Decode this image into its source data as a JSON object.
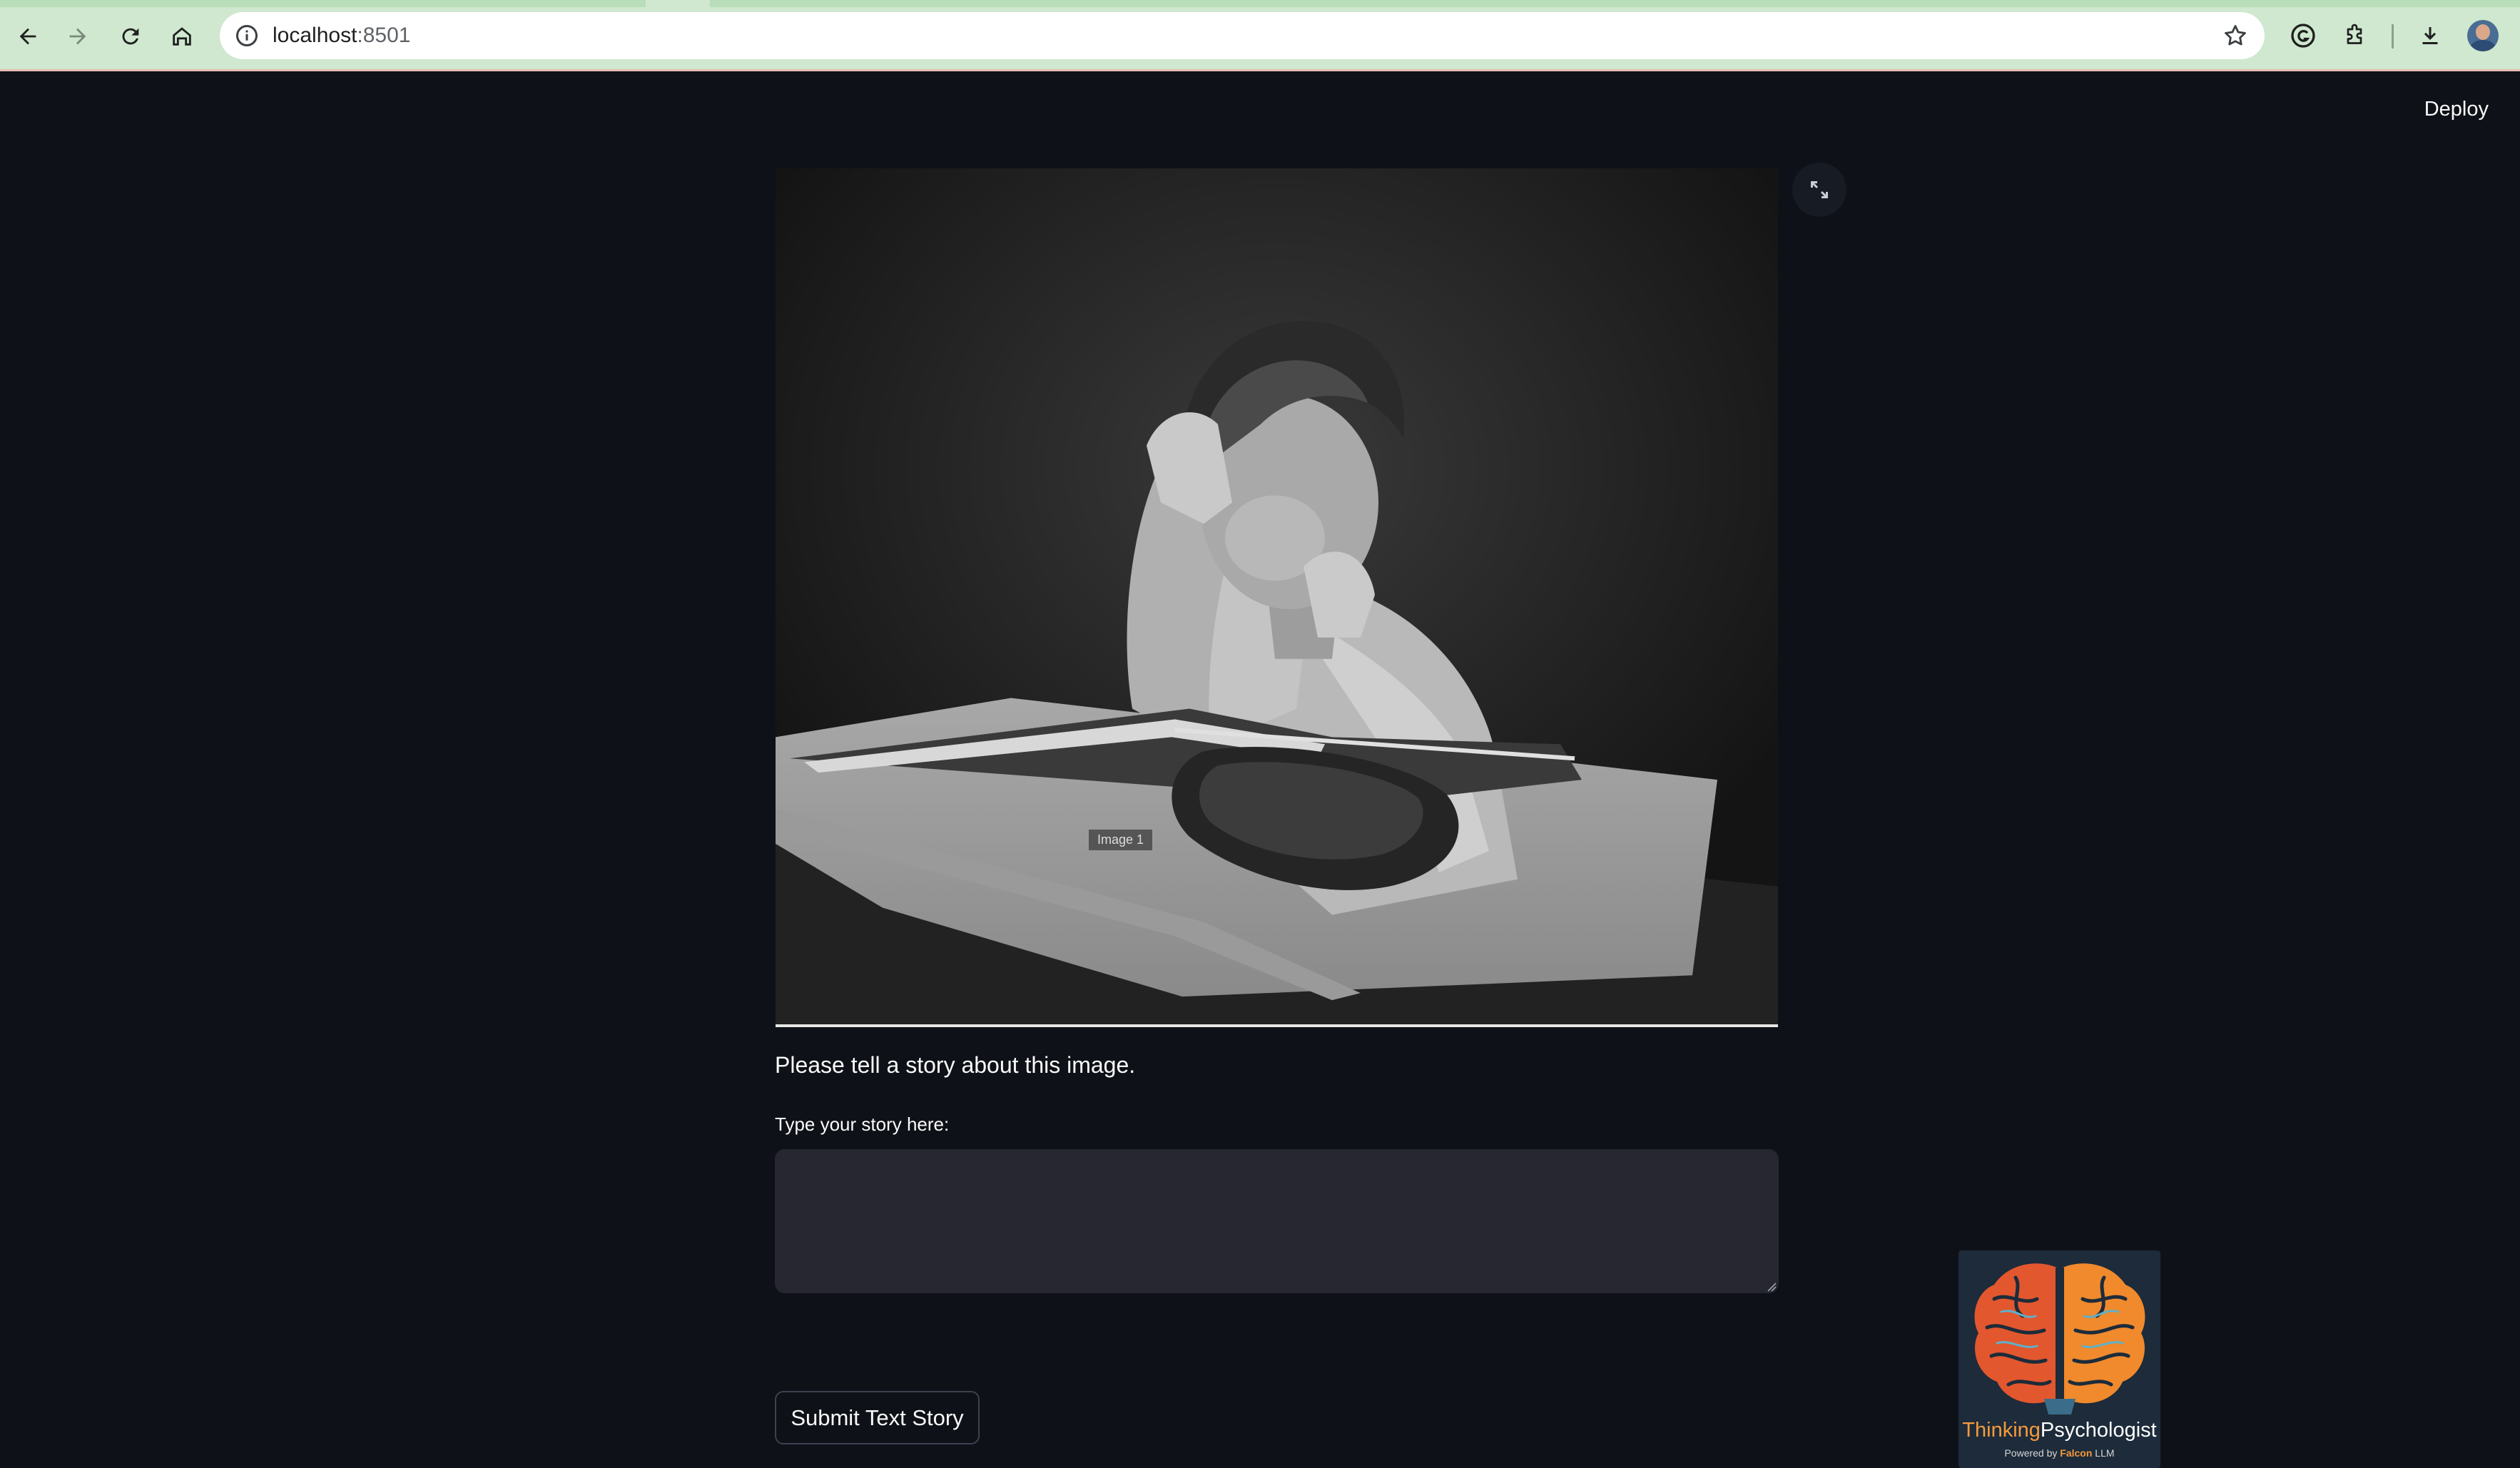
{
  "browser": {
    "url_host": "localhost",
    "url_port": ":8501"
  },
  "app": {
    "deploy_label": "Deploy",
    "image_caption": "Image 1",
    "prompt_text": "Please tell a story about this image.",
    "input_label": "Type your story here:",
    "input_value": "",
    "submit_label": "Submit Text Story",
    "logo": {
      "title_part1": "Thinking",
      "title_part2": "Psychologist",
      "powered_by": "Powered by",
      "brand": "Falcon",
      "brand_suffix": "LLM"
    }
  },
  "colors": {
    "background": "#0e1117",
    "input_bg": "#262730",
    "text": "#fafafa",
    "logo_accent": "#f59a3b",
    "chrome_bg": "#cfe8cf"
  }
}
